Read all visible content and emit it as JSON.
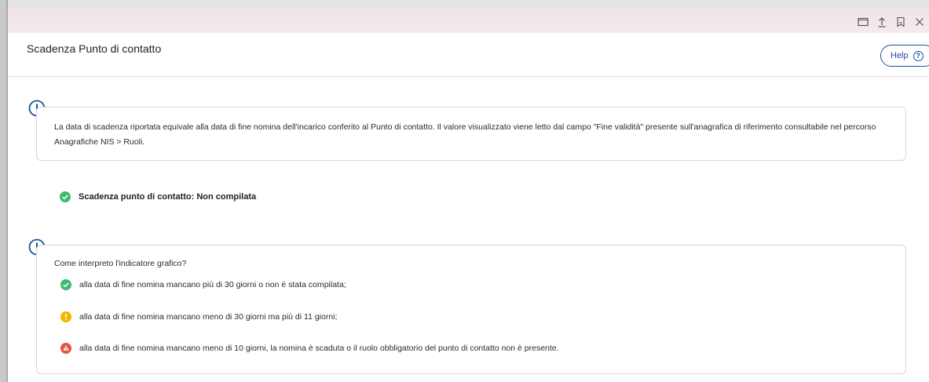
{
  "window": {
    "icons": [
      "maximize-icon",
      "upload-icon",
      "bookmark-icon",
      "close-icon"
    ]
  },
  "header": {
    "title": "Scadenza Punto di contatto",
    "help_label": "Help",
    "help_symbol": "?"
  },
  "info": {
    "text": "La data di scadenza riportata equivale alla data di fine nomina dell'incarico conferito al Punto di contatto. Il valore visualizzato viene letto dal campo \"Fine validità\" presente sull'anagrafica di riferimento consultabile nel percorso Anagrafiche NIS > Ruoli."
  },
  "status": {
    "label": "Scadenza punto di contatto: Non compilata",
    "state": "green"
  },
  "legend": {
    "title": "Come interpreto l'indicatore grafico?",
    "items": [
      {
        "state": "green",
        "text": "alla data di fine nomina mancano più di 30 giorni o non è stata compilata;"
      },
      {
        "state": "yellow",
        "text": "alla data di fine nomina mancano meno di 30 giorni ma più di 11 giorni;"
      },
      {
        "state": "red",
        "text": "alla data di fine nomina mancano meno di 10 giorni, la nomina è scaduta o il ruolo obbligatorio del punto di contatto non è presente."
      }
    ]
  },
  "colors": {
    "accent": "#1b4f9e",
    "green": "#3cba6f",
    "yellow": "#f5b400",
    "red": "#e5533d"
  }
}
